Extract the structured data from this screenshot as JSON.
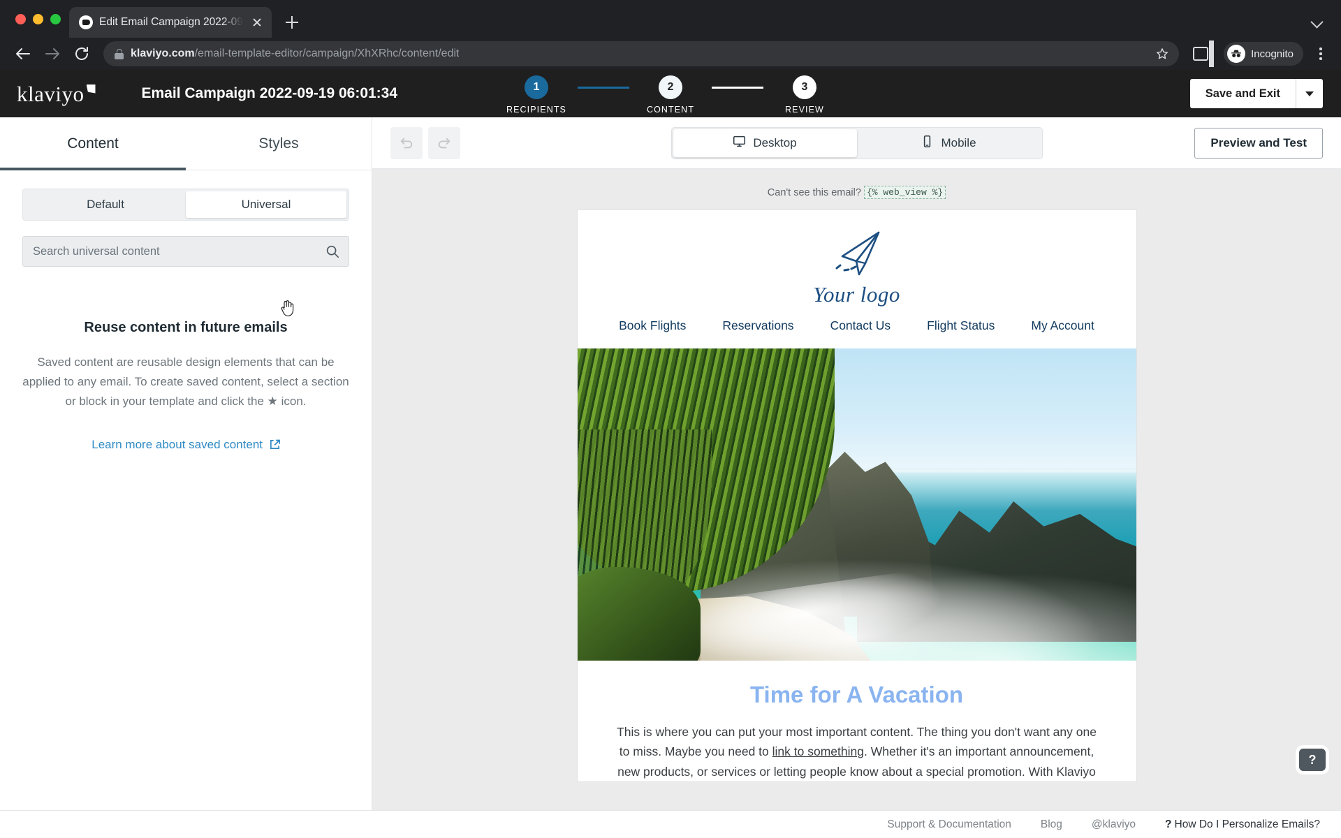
{
  "browser": {
    "tab": {
      "title": "Edit Email Campaign 2022-09-",
      "favicon": "window-icon"
    },
    "url": {
      "host": "klaviyo.com",
      "path": "/email-template-editor/campaign/XhXRhc/content/edit"
    },
    "profile_label": "Incognito"
  },
  "app": {
    "brand": "klaviyo",
    "campaign_title": "Email Campaign 2022-09-19 06:01:34",
    "steps": [
      {
        "number": "1",
        "label": "RECIPIENTS",
        "state": "active"
      },
      {
        "number": "2",
        "label": "CONTENT",
        "state": "current"
      },
      {
        "number": "3",
        "label": "REVIEW",
        "state": "upcoming"
      }
    ],
    "accent_blue": "#1a6a9e",
    "save_label": "Save and Exit"
  },
  "left_panel": {
    "tabs": [
      {
        "label": "Content",
        "active": true
      },
      {
        "label": "Styles",
        "active": false
      }
    ],
    "segment": [
      {
        "label": "Default",
        "selected": false
      },
      {
        "label": "Universal",
        "selected": true
      }
    ],
    "search": {
      "value": "",
      "placeholder": "Search universal content"
    },
    "empty_state": {
      "title": "Reuse content in future emails",
      "description": "Saved content are reusable design elements that can be applied to any email. To create saved content, select a section or block in your template and click the ★ icon.",
      "link": "Learn more about saved content"
    }
  },
  "toolbar": {
    "undo": "undo",
    "redo": "redo",
    "devices": [
      {
        "label": "Desktop",
        "selected": true
      },
      {
        "label": "Mobile",
        "selected": false
      }
    ],
    "preview_label": "Preview and Test"
  },
  "email": {
    "webview_prefix": "Can't see this email?",
    "webview_tag": "{% web_view %}",
    "logo_text": "Your logo",
    "nav": [
      "Book Flights",
      "Reservations",
      "Contact Us",
      "Flight Status",
      "My Account"
    ],
    "heading": "Time for A Vacation",
    "heading_color": "#8ab4f0",
    "paragraph_part1": "This is where you can put your most important content. The thing you don't want any one to miss. Maybe you need to ",
    "paragraph_link": "link to something",
    "paragraph_part2": ". Whether it's an important announcement, new products, or services or letting people know about a special promotion. With Klaviyo"
  },
  "footer": {
    "links": [
      "Support & Documentation",
      "Blog",
      "@klaviyo"
    ],
    "help_question": "How Do I Personalize Emails?",
    "help_fab": "?"
  }
}
